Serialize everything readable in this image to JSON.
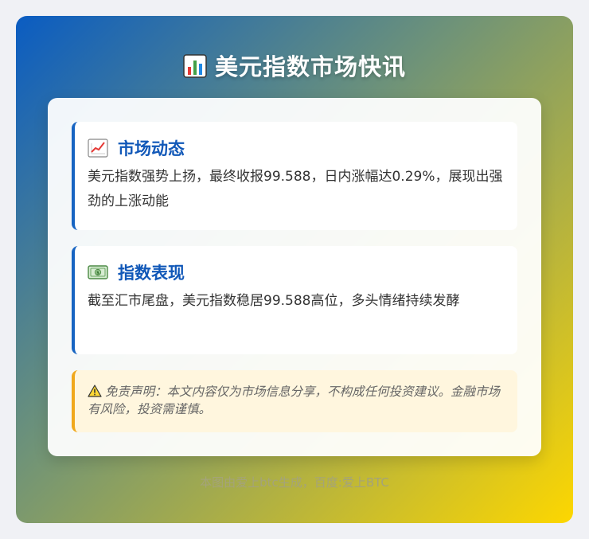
{
  "header": {
    "icon": "bar-chart-icon",
    "title": "美元指数市场快讯"
  },
  "sections": [
    {
      "icon": "trending-up-icon",
      "heading": "市场动态",
      "body": "美元指数强势上扬，最终收报99.588，日内涨幅达0.29%，展现出强劲的上涨动能"
    },
    {
      "icon": "dollar-bill-icon",
      "heading": "指数表现",
      "body": "截至汇市尾盘，美元指数稳居99.588高位，多头情绪持续发酵"
    }
  ],
  "disclaimer": {
    "icon": "warning-icon",
    "text": "免责声明：本文内容仅为市场信息分享，不构成任何投资建议。金融市场有风险，投资需谨慎。"
  },
  "footer": {
    "text": "本图由爱上btc生成，百度:爱上BTC"
  },
  "colors": {
    "accent": "#1764c2",
    "heading": "#1158b8",
    "warning_border": "#f0a81c",
    "warning_bg": "#fff6de",
    "gradient_start": "#0a5cc2",
    "gradient_end": "#fdd700"
  }
}
